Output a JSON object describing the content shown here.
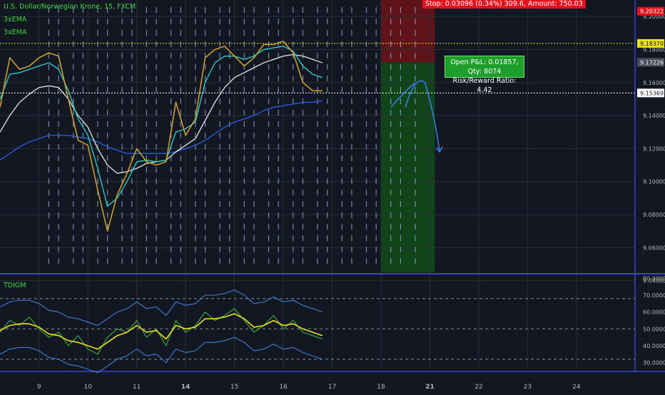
{
  "colors": {
    "bg": "#131722",
    "price": "#c7a02e",
    "ema_fast": "#2dc8c8",
    "ema_mid": "#d9d9d9",
    "ema_slow": "#2a5ad8",
    "stop_zone": "#6e1418",
    "profit_zone": "#0f4d16",
    "tdi_line": "#e8e020",
    "tdi_fast": "#3fae3f",
    "tdi_band": "#3d7fd6",
    "accent_red": "#e1121d",
    "accent_green": "#1e9e2a",
    "current_price": "#ffffff",
    "hline_yellow": "#e8e020"
  },
  "header": {
    "symbol_title": "U.S. Dollar/Norwegian Krone, 15, FXCM",
    "indicators": [
      "3xEMA",
      "3xEMA"
    ]
  },
  "position": {
    "stop_label": "Stop: 0.03096 (0.34%) 309.6, Amount: 750.03",
    "pnl_label": "Open P&L: 0.01857, Qty: 8074",
    "rr_label": "Risk/Reward Ratio: 4.42",
    "stop_price": 9.20322,
    "entry_price": 9.17226,
    "target_price": 9.04
  },
  "price_axis": {
    "min": 9.045,
    "max": 9.21,
    "ticks": [
      "9.04000",
      "9.06000",
      "9.08000",
      "9.10000",
      "9.12000",
      "9.14000",
      "9.16000",
      "9.18000",
      "9.20000"
    ],
    "tick_values": [
      9.04,
      9.06,
      9.08,
      9.1,
      9.12,
      9.14,
      9.16,
      9.18,
      9.2
    ],
    "price_labels": [
      {
        "text": "9.20322",
        "value": 9.20322,
        "kind": "stop"
      },
      {
        "text": "9.18370",
        "value": 9.1837,
        "kind": "level"
      },
      {
        "text": "9.17226",
        "value": 9.17226,
        "kind": "entry"
      },
      {
        "text": "9.15369",
        "value": 9.15369,
        "kind": "current"
      }
    ]
  },
  "indicator_panel": {
    "name": "TDIGM",
    "min": 26,
    "max": 81,
    "ticks": [
      "30.00000",
      "40.00000",
      "50.00000",
      "60.00000",
      "70.00000",
      "80.00000"
    ],
    "tick_values": [
      30,
      40,
      50,
      60,
      70,
      80
    ],
    "dashed_levels": [
      32,
      50,
      68
    ]
  },
  "time_axis": {
    "labels": [
      "9",
      "10",
      "11",
      "14",
      "15",
      "16",
      "17",
      "18",
      "21",
      "22",
      "23",
      "24"
    ],
    "bold": [
      false,
      false,
      false,
      true,
      false,
      false,
      false,
      false,
      true,
      false,
      false,
      false
    ],
    "positions": [
      0,
      10,
      20,
      30,
      40,
      50,
      60,
      70,
      80,
      90,
      100,
      110
    ],
    "x_max": 122,
    "session_lines": [
      2,
      4,
      7,
      9,
      12,
      14,
      17,
      19,
      22,
      24,
      27,
      29,
      32,
      34,
      37,
      39,
      42,
      44,
      47,
      49,
      52,
      54,
      57,
      59,
      62,
      64,
      67,
      69,
      72,
      74,
      77
    ]
  },
  "chart_data": {
    "type": "line",
    "title": "U.S. Dollar/Norwegian Krone, 15, FXCM",
    "x": [
      -8,
      -6,
      -4,
      -2,
      0,
      2,
      4,
      6,
      8,
      10,
      12,
      14,
      16,
      18,
      20,
      22,
      24,
      26,
      28,
      30,
      32,
      34,
      36,
      38,
      40,
      42,
      44,
      46,
      48,
      50,
      52,
      54,
      56,
      58,
      60,
      62,
      64,
      66,
      68,
      70,
      72,
      74,
      76,
      78
    ],
    "series": [
      {
        "name": "price",
        "values": [
          9.145,
          9.175,
          9.168,
          9.17,
          9.175,
          9.178,
          9.176,
          9.15,
          9.125,
          9.122,
          9.095,
          9.07,
          9.092,
          9.105,
          9.12,
          9.112,
          9.11,
          9.112,
          9.148,
          9.128,
          9.138,
          9.175,
          9.18,
          9.182,
          9.176,
          9.17,
          9.175,
          9.183,
          9.183,
          9.185,
          9.178,
          9.16,
          9.155,
          9.155
        ]
      },
      {
        "name": "3xEMA",
        "values": [
          9.15,
          9.165,
          9.166,
          9.168,
          9.17,
          9.172,
          9.168,
          9.155,
          9.138,
          9.128,
          9.108,
          9.085,
          9.09,
          9.1,
          9.112,
          9.113,
          9.112,
          9.113,
          9.13,
          9.132,
          9.136,
          9.16,
          9.172,
          9.176,
          9.176,
          9.174,
          9.176,
          9.18,
          9.181,
          9.182,
          9.179,
          9.17,
          9.165,
          9.163
        ]
      },
      {
        "name": "3xEMA",
        "values": [
          9.13,
          9.14,
          9.148,
          9.153,
          9.157,
          9.158,
          9.157,
          9.15,
          9.14,
          9.133,
          9.12,
          9.11,
          9.105,
          9.106,
          9.108,
          9.111,
          9.112,
          9.113,
          9.118,
          9.122,
          9.126,
          9.137,
          9.148,
          9.157,
          9.163,
          9.166,
          9.169,
          9.172,
          9.174,
          9.176,
          9.177,
          9.176,
          9.174,
          9.172
        ]
      },
      {
        "name": "ema_slow",
        "values": [
          9.113,
          9.117,
          9.121,
          9.124,
          9.126,
          9.128,
          9.128,
          9.128,
          9.127,
          9.126,
          9.124,
          9.121,
          9.119,
          9.117,
          9.117,
          9.117,
          9.117,
          9.117,
          9.118,
          9.12,
          9.122,
          9.125,
          9.129,
          9.133,
          9.136,
          9.138,
          9.14,
          9.143,
          9.145,
          9.146,
          9.147,
          9.148,
          9.148,
          9.149
        ]
      },
      {
        "name": "TDIGM",
        "values": [
          48,
          55,
          52,
          57,
          50,
          45,
          48,
          40,
          46,
          38,
          35,
          45,
          50,
          48,
          55,
          45,
          50,
          40,
          55,
          48,
          52,
          60,
          55,
          58,
          62,
          55,
          48,
          52,
          58,
          50,
          55,
          48,
          46,
          44
        ]
      },
      {
        "name": "tdi_signal",
        "values": [
          49,
          52,
          53,
          53,
          51,
          47,
          46,
          43,
          42,
          40,
          38,
          42,
          46,
          48,
          52,
          48,
          49,
          44,
          52,
          50,
          51,
          56,
          56,
          57,
          59,
          56,
          51,
          52,
          55,
          52,
          53,
          50,
          48,
          46
        ]
      }
    ]
  }
}
